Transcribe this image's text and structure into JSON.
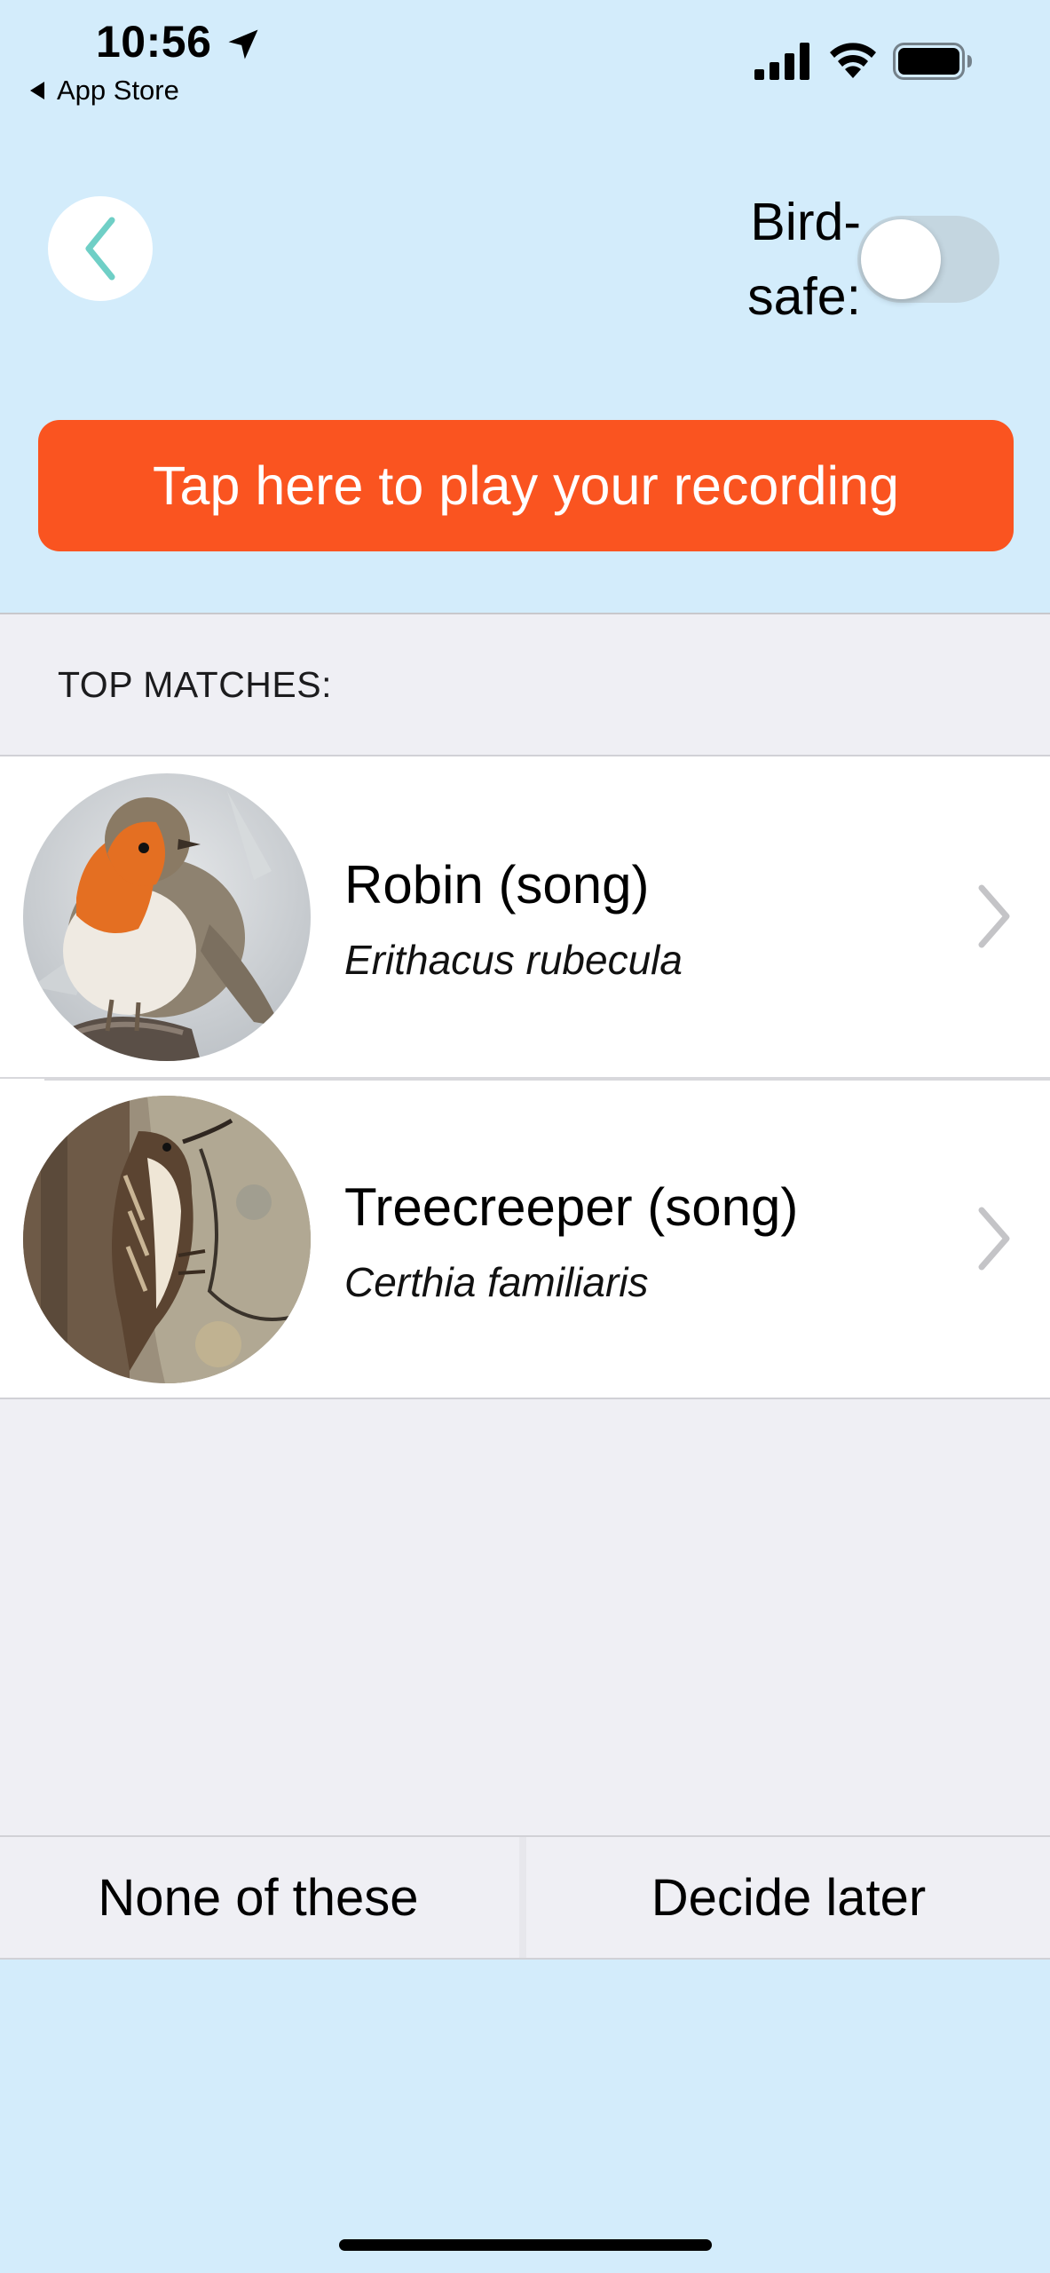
{
  "status_bar": {
    "time": "10:56",
    "back_app_label": "App Store"
  },
  "header": {
    "birdsafe_line1": "Bird-",
    "birdsafe_line2": "safe:",
    "birdsafe_enabled": false
  },
  "play_button": {
    "label": "Tap here to play your recording",
    "color": "#fa5420"
  },
  "section": {
    "title": "TOP MATCHES:"
  },
  "matches": [
    {
      "name": "Robin (song)",
      "latin": "Erithacus rubecula",
      "image": "robin-photo"
    },
    {
      "name": "Treecreeper (song)",
      "latin": "Certhia familiaris",
      "image": "treecreeper-photo"
    }
  ],
  "bottom_actions": {
    "none_label": "None of these",
    "later_label": "Decide later"
  },
  "colors": {
    "background": "#d3ecfb",
    "accent_teal": "#6fcfc6",
    "list_background": "#efeff4"
  }
}
